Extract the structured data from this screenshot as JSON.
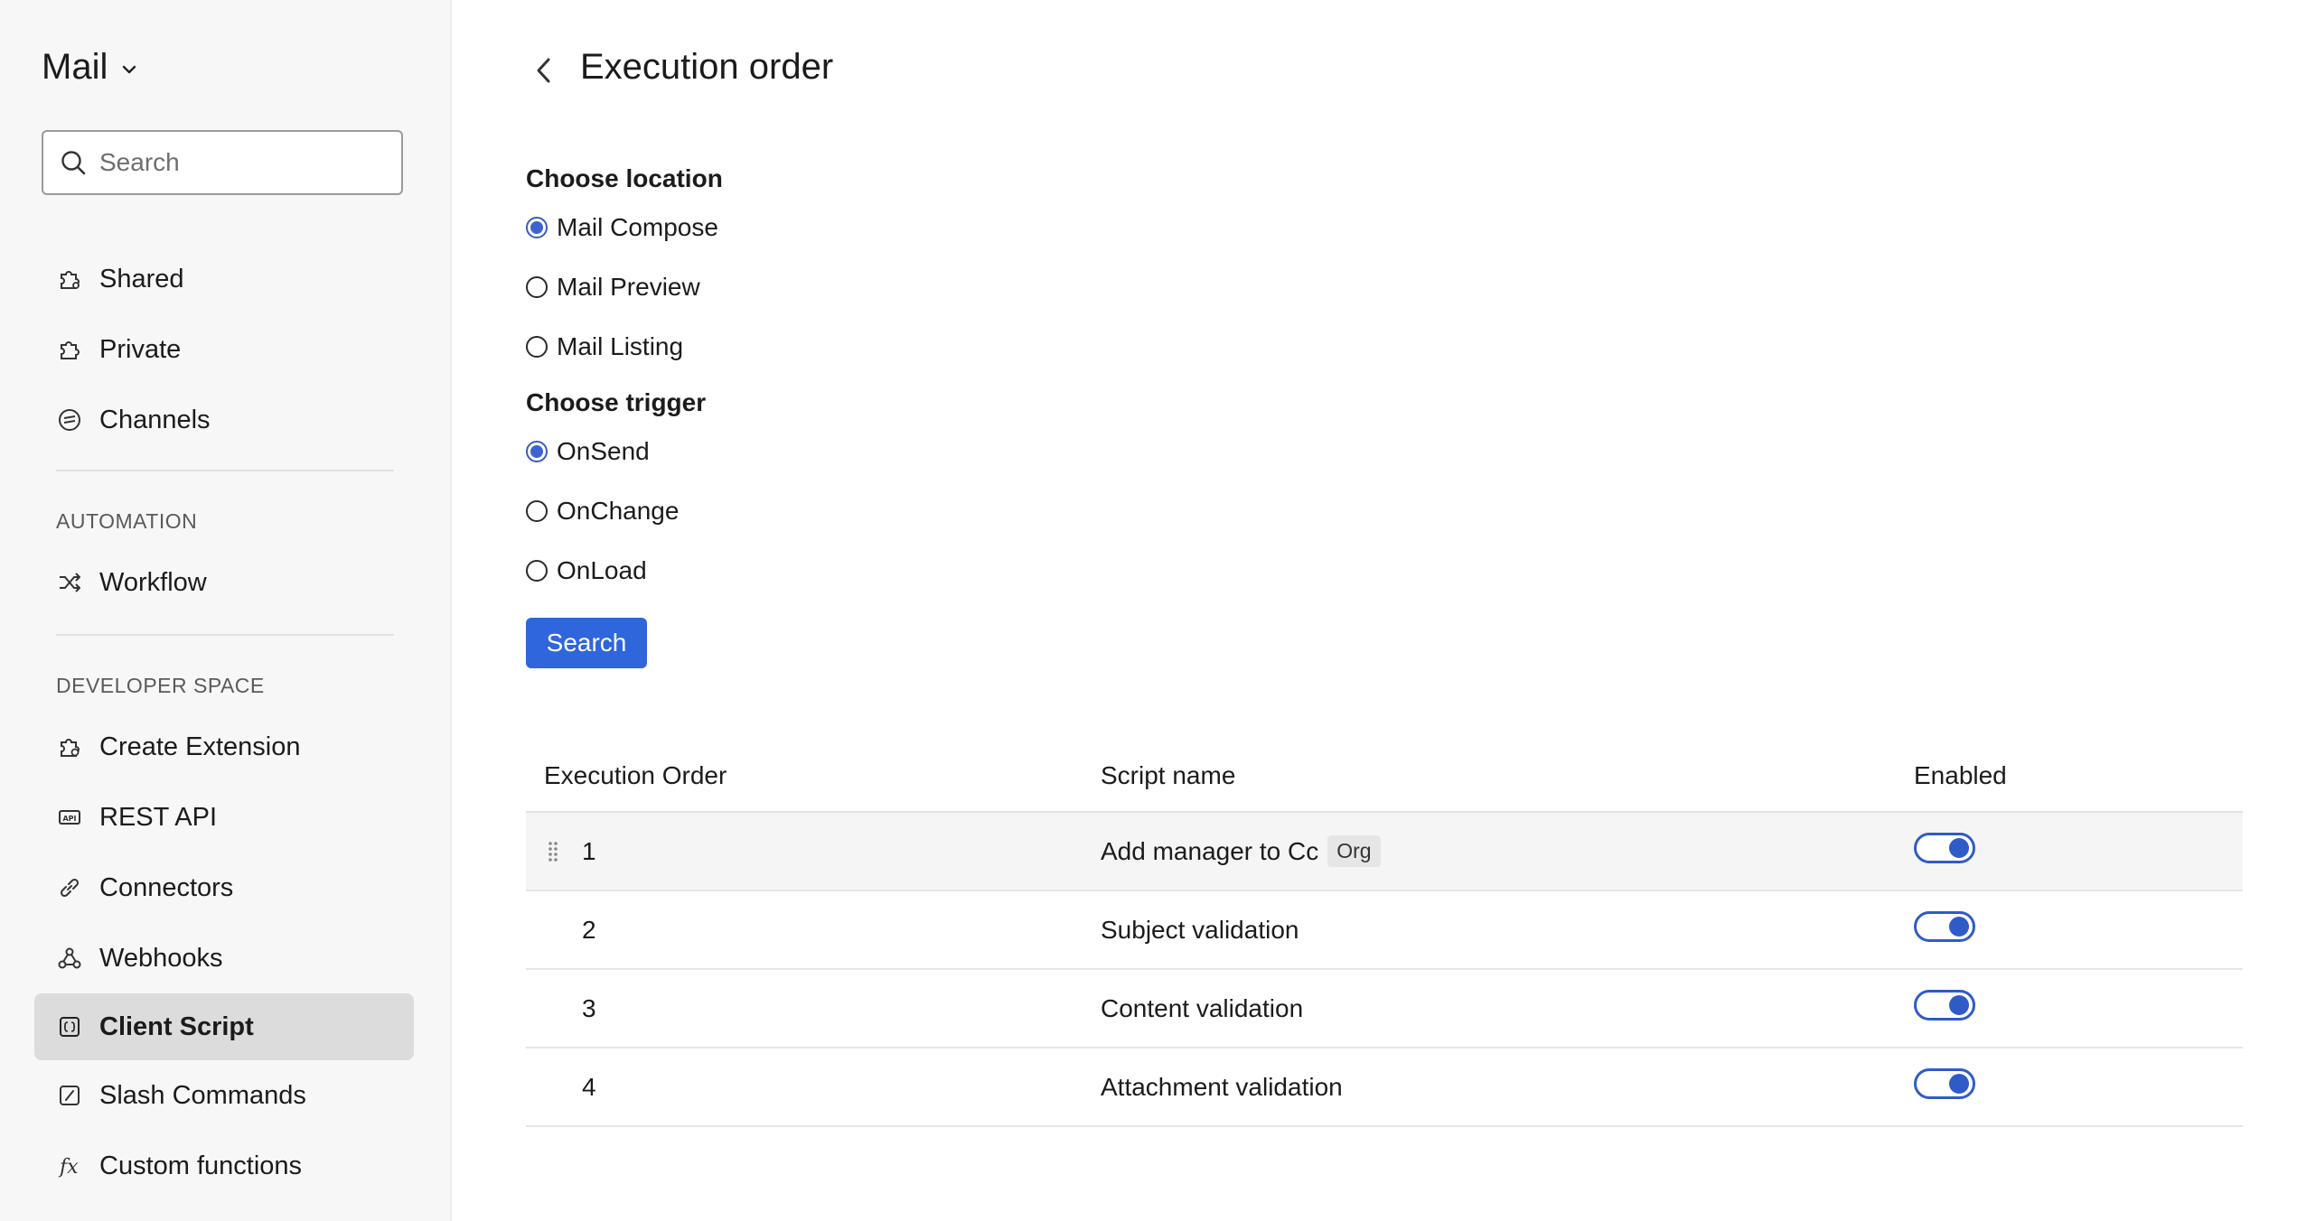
{
  "sidebar": {
    "app_title": "Mail",
    "search_placeholder": "Search",
    "items": [
      {
        "label": "Shared",
        "icon": "puzzle-shared-icon"
      },
      {
        "label": "Private",
        "icon": "puzzle-icon"
      },
      {
        "label": "Channels",
        "icon": "channels-icon"
      }
    ],
    "automation": {
      "label": "AUTOMATION",
      "items": [
        {
          "label": "Workflow",
          "icon": "shuffle-icon"
        }
      ]
    },
    "developer_space": {
      "label": "DEVELOPER SPACE",
      "items": [
        {
          "label": "Create Extension",
          "icon": "extension-gear-icon"
        },
        {
          "label": "REST API",
          "icon": "api-icon"
        },
        {
          "label": "Connectors",
          "icon": "link-icon"
        },
        {
          "label": "Webhooks",
          "icon": "webhook-icon"
        },
        {
          "label": "Client Script",
          "icon": "script-icon",
          "active": true
        },
        {
          "label": "Slash Commands",
          "icon": "slash-icon"
        },
        {
          "label": "Custom functions",
          "icon": "function-icon"
        }
      ]
    }
  },
  "main": {
    "title": "Execution order",
    "location": {
      "label": "Choose location",
      "options": [
        "Mail Compose",
        "Mail Preview",
        "Mail Listing"
      ],
      "selected": "Mail Compose"
    },
    "trigger": {
      "label": "Choose trigger",
      "options": [
        "OnSend",
        "OnChange",
        "OnLoad"
      ],
      "selected": "OnSend"
    },
    "search_button": "Search",
    "table": {
      "headers": [
        "Execution Order",
        "Script name",
        "Enabled"
      ],
      "rows": [
        {
          "order": "1",
          "name": "Add manager to Cc",
          "badge": "Org",
          "enabled": true
        },
        {
          "order": "2",
          "name": "Subject validation",
          "badge": "",
          "enabled": true
        },
        {
          "order": "3",
          "name": "Content validation",
          "badge": "",
          "enabled": true
        },
        {
          "order": "4",
          "name": "Attachment validation",
          "badge": "",
          "enabled": true
        }
      ]
    }
  },
  "colors": {
    "accent": "#2f66db",
    "toggle": "#2f5bc9",
    "sidebar_bg": "#f7f7f7",
    "active_item_bg": "#dcdcdc"
  }
}
